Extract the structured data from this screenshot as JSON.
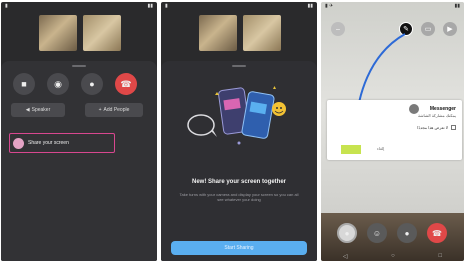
{
  "phone1": {
    "buttons": {
      "speaker_label": "Speaker",
      "add_people_label": "Add People"
    },
    "share_screen_label": "Share your screen"
  },
  "phone2": {
    "title": "New! Share your screen together",
    "body": "Take turns with your camera and display your screen so you can all see whatever your doing",
    "button_label": "Start Sharing"
  },
  "phone3": {
    "card_title": "Messenger",
    "card_subtitle": "يمكنك مشاركة الشاشة",
    "card_checkbox": "لا تعرض هذا مجددًا",
    "card_primary": "",
    "card_secondary": "إلغاء"
  },
  "colors": {
    "accent_blue": "#5aaef0",
    "end_call_red": "#e04848",
    "highlight_pink": "#d8478f",
    "confirm_green": "#c7e34f"
  }
}
